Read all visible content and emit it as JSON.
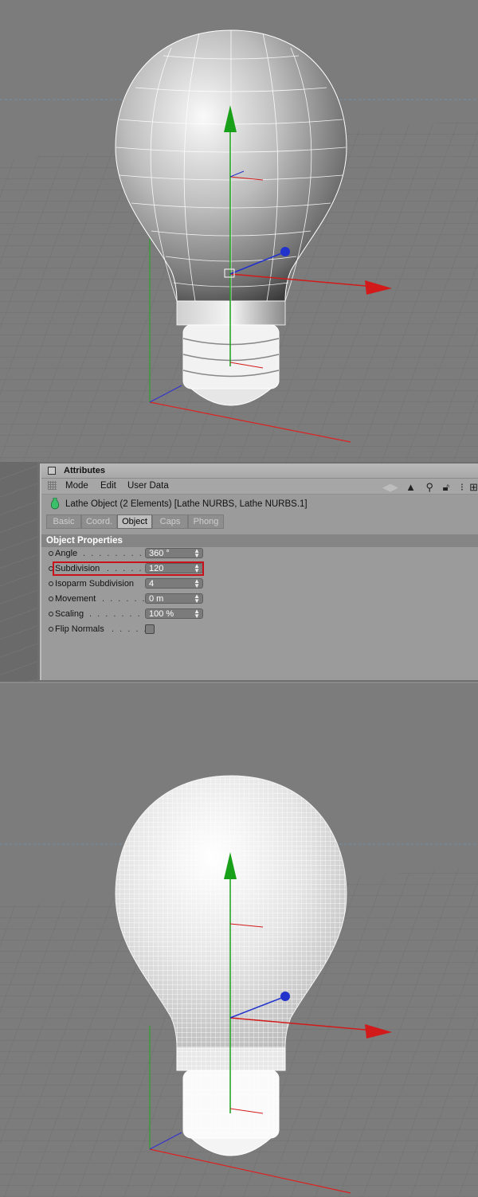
{
  "attributes": {
    "title": "Attributes",
    "menu": [
      "Mode",
      "Edit",
      "User Data"
    ],
    "object_line": "Lathe Object (2 Elements) [Lathe NURBS, Lathe NURBS.1]",
    "tabs": [
      "Basic",
      "Coord.",
      "Object",
      "Caps",
      "Phong"
    ],
    "active_tab": "Object",
    "section": "Object Properties",
    "properties": [
      {
        "label": "Angle",
        "value": "360 °"
      },
      {
        "label": "Subdivision",
        "value": "120"
      },
      {
        "label": "Isoparm Subdivision",
        "value": "4"
      },
      {
        "label": "Movement",
        "value": "0 m"
      },
      {
        "label": "Scaling",
        "value": "100 %"
      },
      {
        "label": "Flip Normals",
        "value": ""
      }
    ],
    "highlighted_property": "Subdivision",
    "toolbar_icons": [
      "back-forward-arrows-icon",
      "pointer-icon",
      "search-icon",
      "lock-icon",
      "hierarchy-icon",
      "new-panel-icon"
    ]
  },
  "colors": {
    "highlight": "#c8111a",
    "axis_y": "#19a019",
    "axis_x": "#d21a1a",
    "axis_z": "#2233cc"
  }
}
